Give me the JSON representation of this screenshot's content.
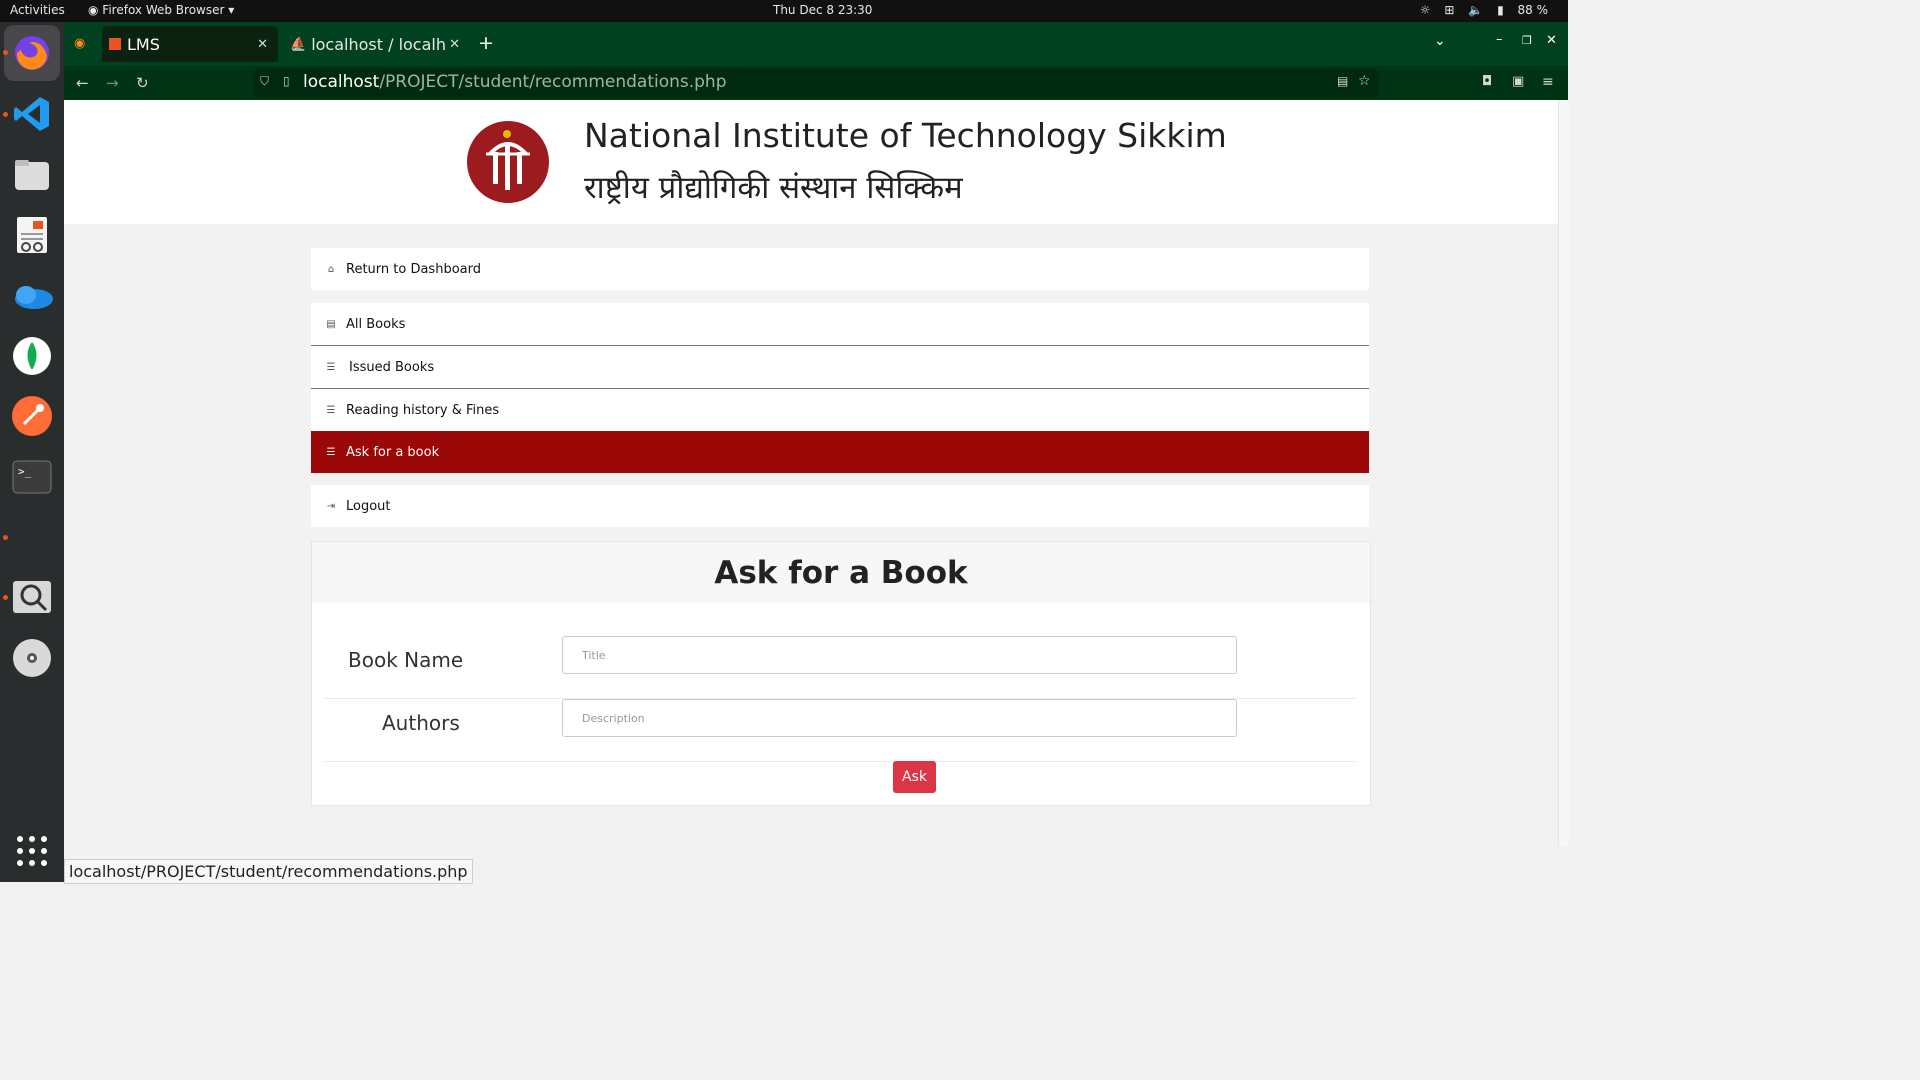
{
  "topbar": {
    "activities": "Activities",
    "app_menu": "Firefox Web Browser ▾",
    "clock": "Thu Dec 8  23:30",
    "battery": "88 %"
  },
  "browser": {
    "tabs": [
      {
        "label": "LMS"
      },
      {
        "label": "localhost / localho"
      }
    ],
    "url_host": "localhost",
    "url_path": "/PROJECT/student/recommendations.php",
    "status_url": "localhost/PROJECT/student/recommendations.php"
  },
  "header": {
    "title_en": "National Institute of Technology Sikkim",
    "title_hi": "राष्ट्रीय प्रौद्योगिकी संस्थान सिक्किम"
  },
  "menu": {
    "dashboard": "Return to Dashboard",
    "all_books": "All Books",
    "issued_books": "Issued Books",
    "history": "Reading history & Fines",
    "ask": "Ask for a book",
    "logout": "Logout"
  },
  "form": {
    "heading": "Ask for a Book",
    "book_name_label": "Book Name",
    "book_name_placeholder": "Title",
    "authors_label": "Authors",
    "authors_placeholder": "Description",
    "submit": "Ask"
  },
  "colors": {
    "accent": "#9a0808",
    "button": "#dc3545",
    "browser_green": "#004120"
  }
}
